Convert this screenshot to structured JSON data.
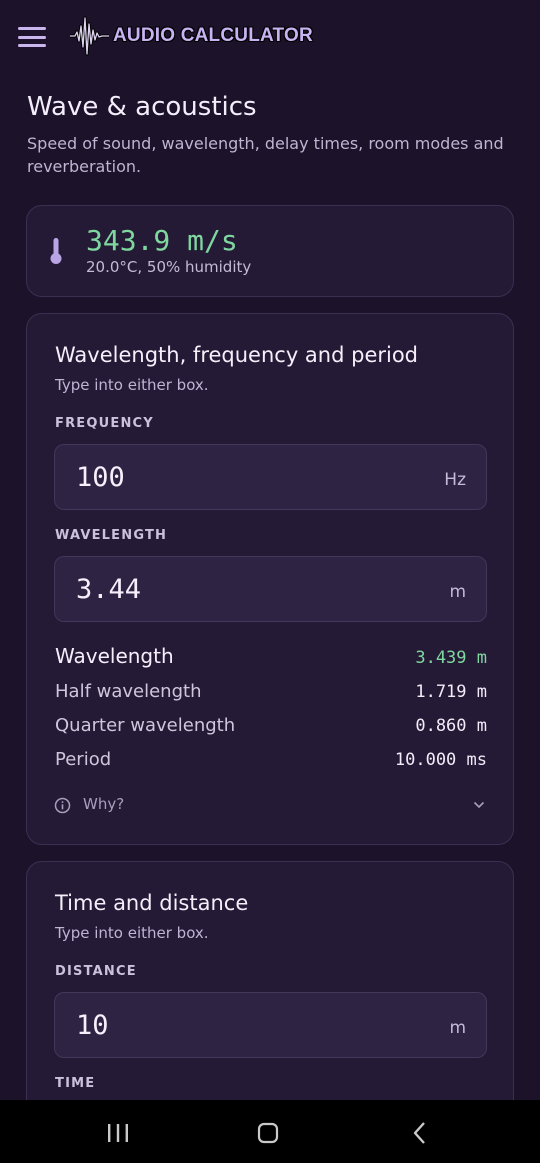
{
  "app": {
    "title": "AUDIO CALCULATOR",
    "menu_icon": "hamburger-menu-icon",
    "logo_icon": "waveform-logo-icon"
  },
  "page": {
    "title": "Wave & acoustics",
    "subtitle": "Speed of sound, wavelength, delay times, room modes and reverberation."
  },
  "sound_speed": {
    "icon": "thermometer-icon",
    "value": "343.9 m/s",
    "conditions": "20.0°C, 50% humidity"
  },
  "wavelength_card": {
    "title": "Wavelength, frequency and period",
    "subtitle": "Type into either box.",
    "frequency": {
      "label": "FREQUENCY",
      "value": "100",
      "unit": "Hz"
    },
    "wavelength": {
      "label": "WAVELENGTH",
      "value": "3.44",
      "unit": "m"
    },
    "results": [
      {
        "label": "Wavelength",
        "value": "3.439 m"
      },
      {
        "label": "Half wavelength",
        "value": "1.719 m"
      },
      {
        "label": "Quarter wavelength",
        "value": "0.860 m"
      },
      {
        "label": "Period",
        "value": "10.000 ms"
      }
    ],
    "why_label": "Why?"
  },
  "time_card": {
    "title": "Time and distance",
    "subtitle": "Type into either box.",
    "distance": {
      "label": "DISTANCE",
      "value": "10",
      "unit": "m"
    },
    "time": {
      "label": "TIME"
    }
  },
  "colors": {
    "accent_green": "#7fd7a0",
    "brand_purple": "#c8b3f2",
    "background": "#1c1229"
  }
}
